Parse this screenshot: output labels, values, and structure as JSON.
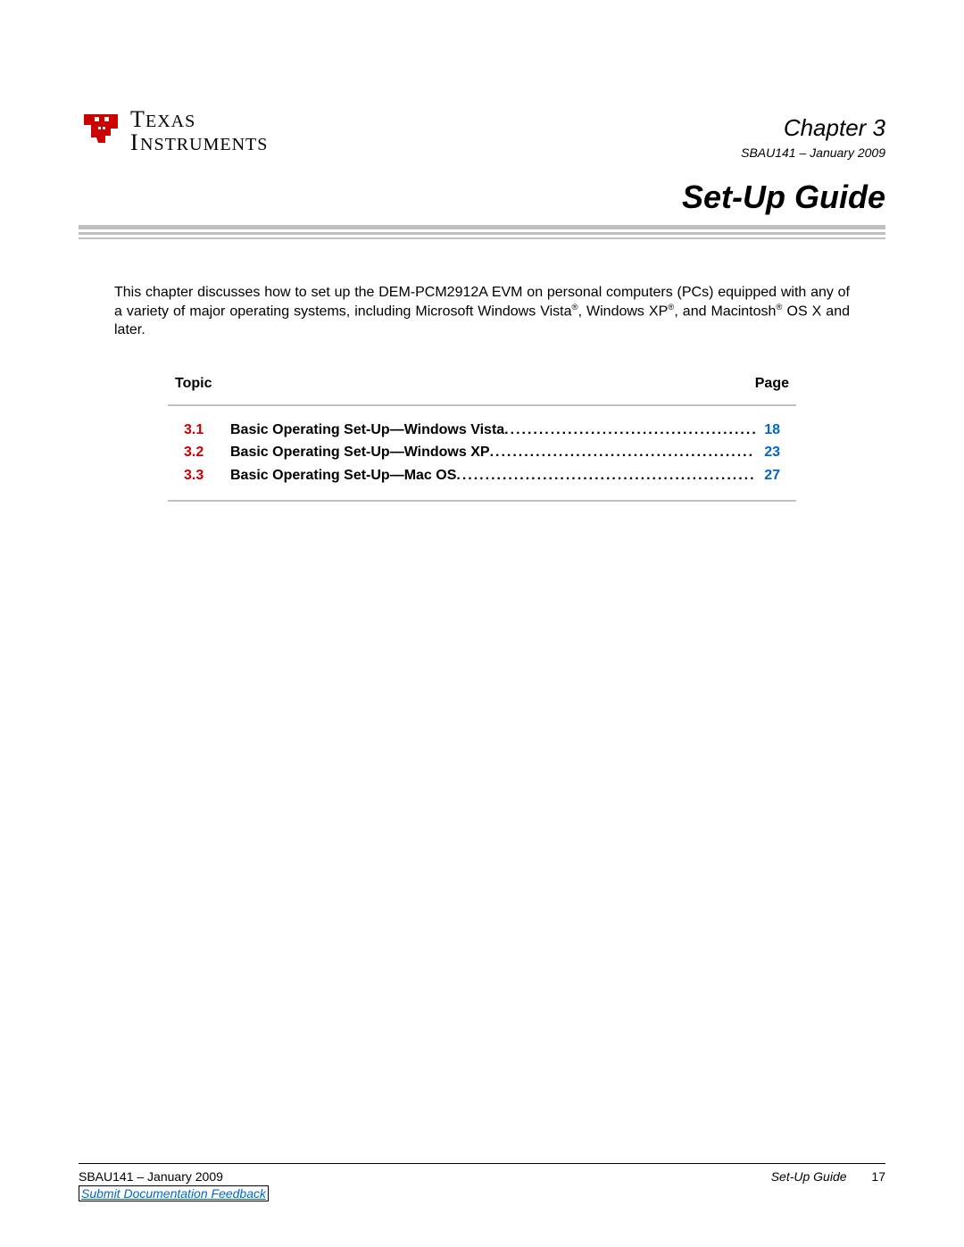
{
  "header": {
    "chapter_label": "Chapter 3",
    "doc_info": "SBAU141 – January 2009"
  },
  "title": "Set-Up Guide",
  "intro": "This chapter discusses how to set up the DEM-PCM2912A EVM on personal computers (PCs) equipped with any of a variety of major operating systems, including Microsoft Windows Vista®, Windows XP®, and Macintosh® OS X and later.",
  "toc": {
    "topic_label": "Topic",
    "page_label": "Page",
    "entries": [
      {
        "num": "3.1",
        "title": "Basic Operating Set-Up—Windows Vista ",
        "page": "18"
      },
      {
        "num": "3.2",
        "title": "Basic Operating Set-Up—Windows XP ",
        "page": "23"
      },
      {
        "num": "3.3",
        "title": "Basic Operating Set-Up—Mac OS ",
        "page": "27"
      }
    ]
  },
  "footer": {
    "left": "SBAU141 – January 2009",
    "right_title": "Set-Up Guide",
    "page_number": "17",
    "link_text": "Submit Documentation Feedback"
  }
}
